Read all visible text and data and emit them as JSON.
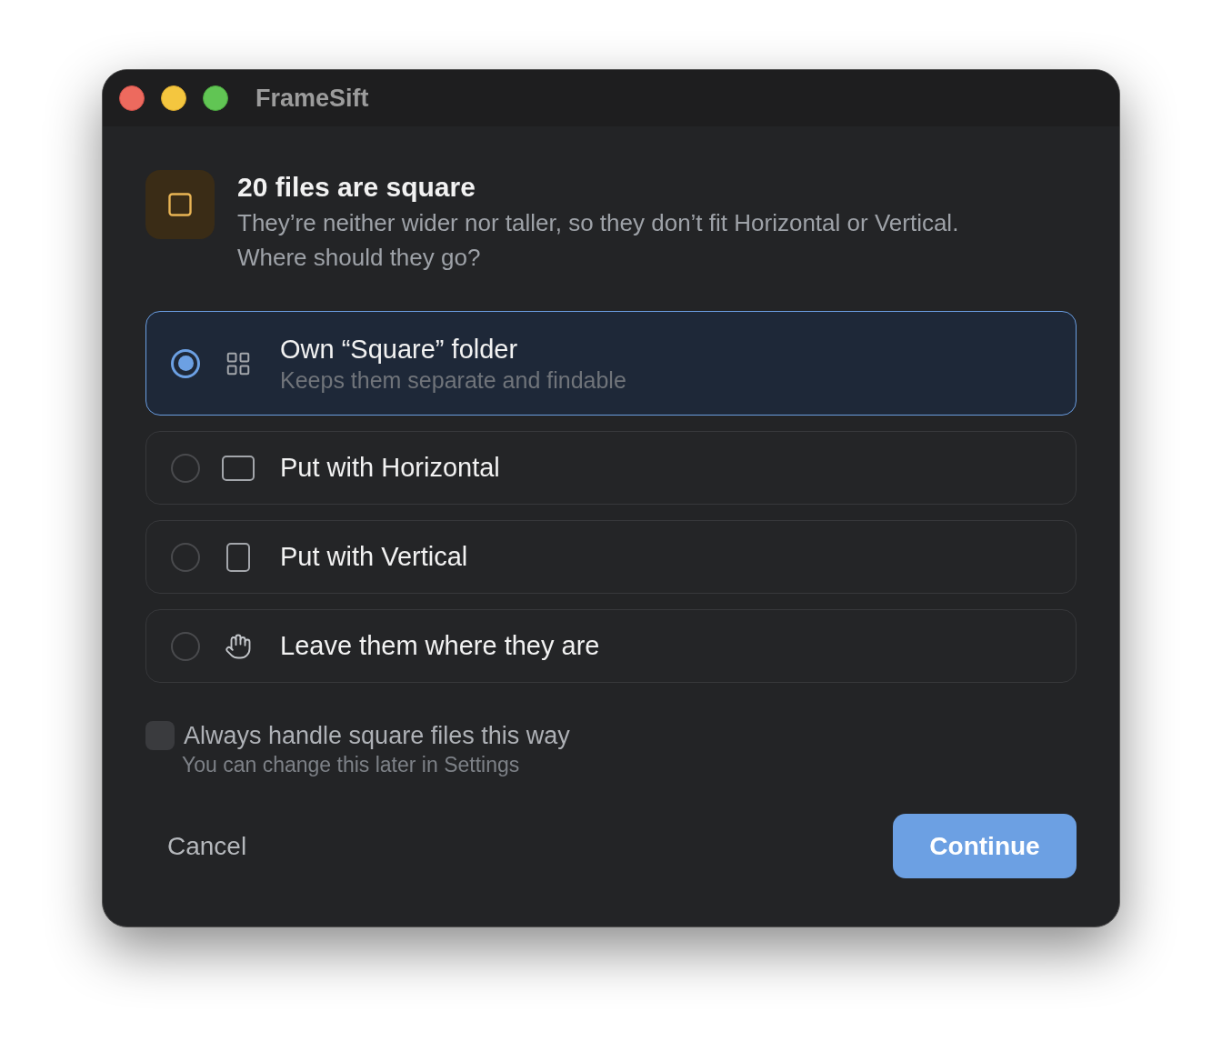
{
  "window": {
    "title": "FrameSift"
  },
  "header": {
    "title": "20 files are square",
    "description": "They’re neither wider nor taller, so they don’t fit Horizontal or Vertical. Where should they go?"
  },
  "options": [
    {
      "kind": "grid",
      "label": "Own “Square” folder",
      "description": "Keeps them separate and findable",
      "selected": true
    },
    {
      "kind": "wide",
      "label": "Put with Horizontal",
      "selected": false
    },
    {
      "kind": "tall",
      "label": "Put with Vertical",
      "selected": false
    },
    {
      "kind": "hand",
      "label": "Leave them where they are",
      "selected": false
    }
  ],
  "remember": {
    "label": "Always handle square files this way",
    "hint": "You can change this later in Settings",
    "checked": false
  },
  "buttons": {
    "cancel": "Cancel",
    "continue": "Continue"
  }
}
